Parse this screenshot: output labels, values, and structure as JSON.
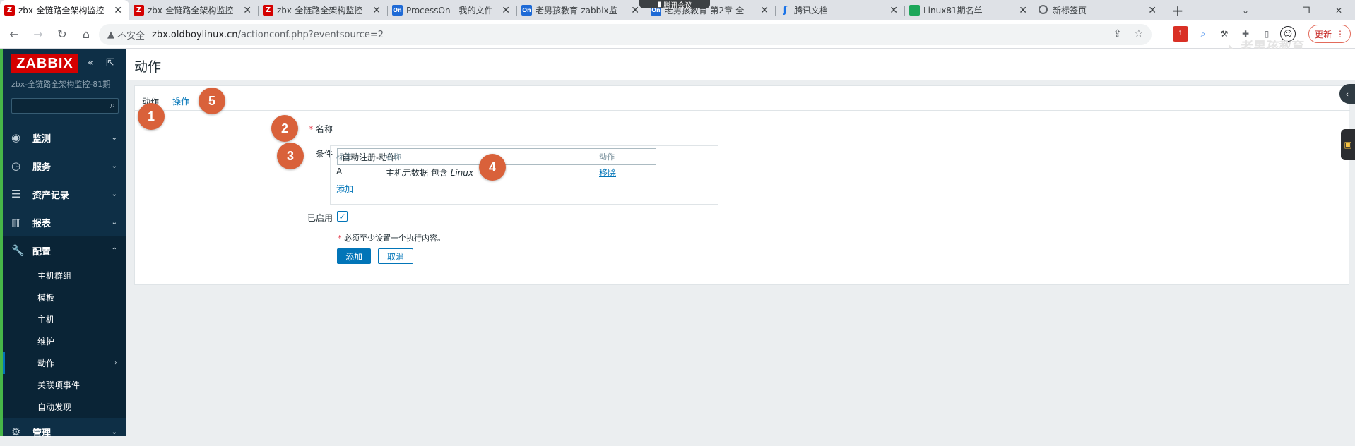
{
  "browser": {
    "tabs": [
      {
        "title": "zbx-全链路全架构监控",
        "favicon": "zabbix-favicon",
        "fav_text": "Z",
        "active": true
      },
      {
        "title": "zbx-全链路全架构监控",
        "favicon": "zabbix-favicon",
        "fav_text": "Z",
        "active": false
      },
      {
        "title": "zbx-全链路全架构监控",
        "favicon": "zabbix-favicon",
        "fav_text": "Z",
        "active": false
      },
      {
        "title": "ProcessOn - 我的文件",
        "favicon": "processon-favicon",
        "fav_text": "On",
        "active": false
      },
      {
        "title": "老男孩教育-zabbix监",
        "favicon": "processon-favicon",
        "fav_text": "On",
        "active": false
      },
      {
        "title": "老男孩教育-第2章-全",
        "favicon": "processon-favicon",
        "fav_text": "On",
        "active": false
      },
      {
        "title": "腾讯文档",
        "favicon": "tencent-docs-favicon",
        "fav_text": "ʃ",
        "active": false
      },
      {
        "title": "Linux81期名单",
        "favicon": "sheet-favicon",
        "fav_text": "",
        "active": false
      },
      {
        "title": "新标签页",
        "favicon": "globe-favicon",
        "fav_text": "",
        "active": false
      }
    ],
    "meeting_label": "腾讯会议",
    "insecure_label": "不安全",
    "url_host": "zbx.oldboylinux.cn",
    "url_path": "/actionconf.php?eventsource=2",
    "update_label": "更新",
    "ext_badge": "1",
    "watermark": "老男孩教育 oldboyedu.com"
  },
  "sidebar": {
    "logo": "ZABBIX",
    "server_name": "zbx-全链路全架构监控-81期",
    "search_placeholder": "",
    "menu": [
      {
        "label": "监测",
        "icon": "eye-icon",
        "glyph": "◉"
      },
      {
        "label": "服务",
        "icon": "clock-icon",
        "glyph": "◷"
      },
      {
        "label": "资产记录",
        "icon": "list-icon",
        "glyph": "☰"
      },
      {
        "label": "报表",
        "icon": "bar-chart-icon",
        "glyph": "▥"
      },
      {
        "label": "配置",
        "icon": "wrench-icon",
        "glyph": "🔧"
      }
    ],
    "config_submenu": [
      "主机群组",
      "模板",
      "主机",
      "维护",
      "动作",
      "关联项事件",
      "自动发现"
    ],
    "admin": {
      "label": "管理",
      "glyph": "⚙"
    }
  },
  "main": {
    "title": "动作",
    "tabs": [
      "动作",
      "操作"
    ],
    "form": {
      "name_label": "名称",
      "name_value": "自动注册-动作",
      "conditions_label": "条件",
      "cond_headers": {
        "tag": "标签",
        "name": "名称",
        "action": "动作"
      },
      "cond_row": {
        "tag": "A",
        "name_prefix": "主机元数据 包含 ",
        "name_value": "Linux",
        "action": "移除"
      },
      "add_link": "添加",
      "enabled_label": "已启用",
      "enabled": true,
      "required_note": "必须至少设置一个执行内容。",
      "submit_label": "添加",
      "cancel_label": "取消"
    }
  },
  "annotations": [
    "1",
    "2",
    "3",
    "4",
    "5"
  ],
  "colors": {
    "zabbix_red": "#d40000",
    "sidebar_bg": "#0e2f46",
    "link_blue": "#0275b8",
    "badge_orange": "#d9613a"
  }
}
